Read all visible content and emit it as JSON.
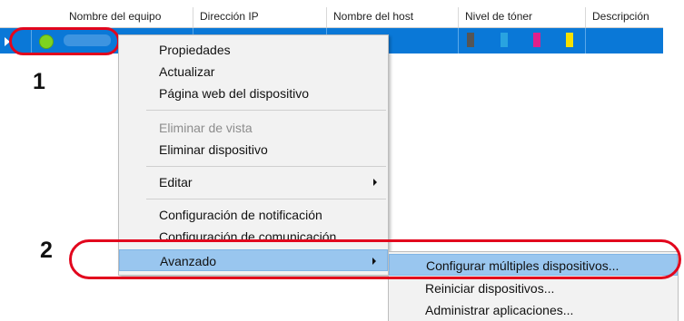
{
  "grid": {
    "columns": [
      "Nombre del equipo",
      "Dirección IP",
      "Nombre del host",
      "Nivel de tóner",
      "Descripción"
    ],
    "toner_colors": [
      "#555555",
      "#29a3e0",
      "#e0208c",
      "#f5e000"
    ]
  },
  "callouts": {
    "row": "1",
    "advanced": "2"
  },
  "context_menu": {
    "items": [
      {
        "label": "Propiedades",
        "enabled": true
      },
      {
        "label": "Actualizar",
        "enabled": true
      },
      {
        "label": "Página web del dispositivo",
        "enabled": true
      },
      {
        "label": "Eliminar de vista",
        "enabled": false
      },
      {
        "label": "Eliminar dispositivo",
        "enabled": true
      },
      {
        "label": "Editar",
        "enabled": true,
        "submenu": true
      },
      {
        "label": "Configuración de notificación",
        "enabled": true
      },
      {
        "label": "Configuración de comunicación",
        "enabled": true
      },
      {
        "label": "Avanzado",
        "enabled": true,
        "submenu": true,
        "highlighted": true
      }
    ]
  },
  "submenu": {
    "items": [
      {
        "label": "Configurar múltiples dispositivos...",
        "highlighted": true
      },
      {
        "label": "Reiniciar dispositivos..."
      },
      {
        "label": "Administrar aplicaciones..."
      }
    ]
  },
  "colors": {
    "selection": "#0a78d7",
    "menu_highlight": "#99c6ef",
    "callout": "#e2061d",
    "status_ok": "#7ed321"
  }
}
